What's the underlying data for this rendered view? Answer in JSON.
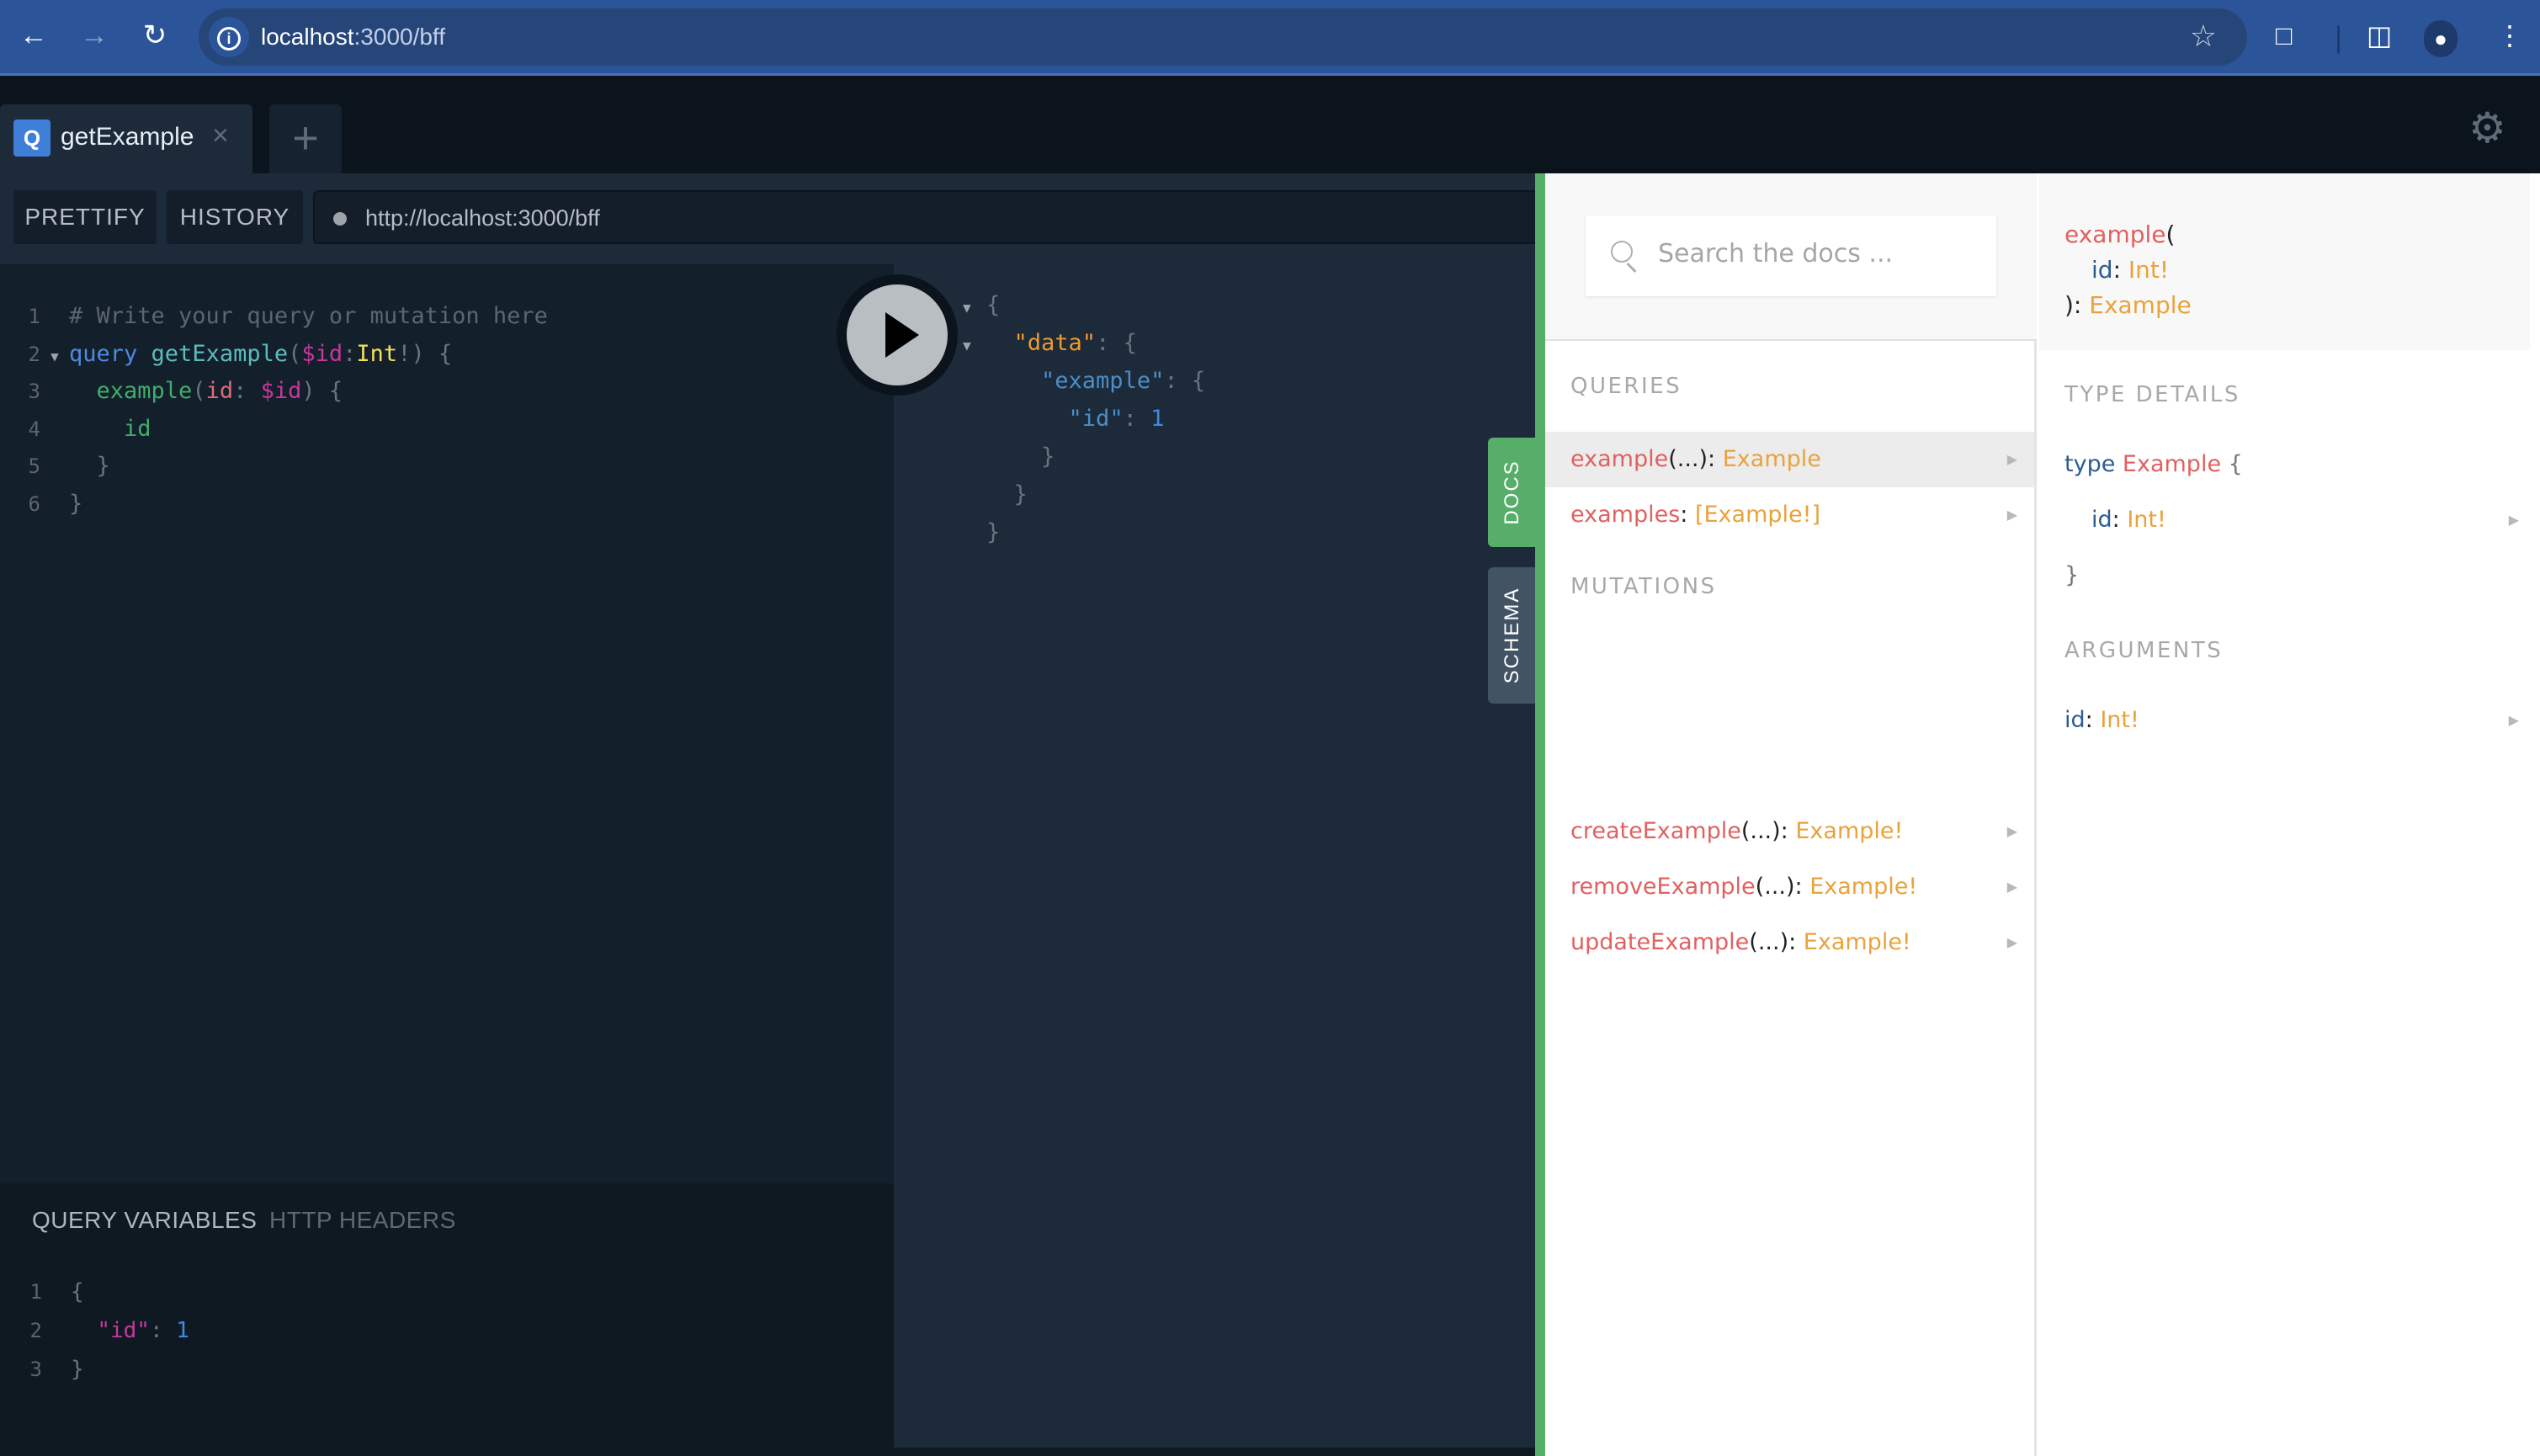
{
  "browser": {
    "url_host": "localhost",
    "url_rest": ":3000/bff",
    "icons": [
      "back-icon",
      "forward-icon",
      "reload-icon",
      "info-icon",
      "star-icon",
      "extensions-icon",
      "side-panel-icon",
      "profile-icon",
      "menu-icon"
    ]
  },
  "tabs": [
    {
      "badge": "Q",
      "title": "getExample",
      "close": "×"
    }
  ],
  "tab_add": "+",
  "toolbar": {
    "prettify": "PRETTIFY",
    "history": "HISTORY",
    "endpoint": "http://localhost:3000/bff"
  },
  "editor": {
    "lines": [
      {
        "n": "1",
        "text": "# Write your query or mutation here"
      },
      {
        "n": "2",
        "text": "query getExample($id:Int!) {"
      },
      {
        "n": "3",
        "text": "  example(id: $id) {"
      },
      {
        "n": "4",
        "text": "    id"
      },
      {
        "n": "5",
        "text": "  }"
      },
      {
        "n": "6",
        "text": "}"
      }
    ],
    "tokens": {
      "comment": "# Write your query or mutation here",
      "kw_query": "query",
      "op_name": "getExample",
      "var": "$id",
      "type": "Int",
      "field": "example",
      "arg": "id",
      "selection": "id"
    }
  },
  "variables": {
    "tab_active": "QUERY VARIABLES",
    "tab_inactive": "HTTP HEADERS",
    "lines": [
      {
        "n": "1",
        "text": "{"
      },
      {
        "n": "2",
        "text": "  \"id\": 1"
      },
      {
        "n": "3",
        "text": "}"
      }
    ],
    "key": "\"id\"",
    "value": "1"
  },
  "response": {
    "data_key": "\"data\"",
    "example_key": "\"example\"",
    "id_key": "\"id\"",
    "id_value": "1"
  },
  "side_tabs": {
    "docs": "DOCS",
    "schema": "SCHEMA"
  },
  "docs": {
    "search_placeholder": "Search the docs ...",
    "queries_title": "QUERIES",
    "queries": [
      {
        "name": "example",
        "args": "(...)",
        "type": "Example",
        "active": true
      },
      {
        "name": "examples",
        "args": "",
        "type": "[Example!]",
        "active": false
      }
    ],
    "mutations_title": "MUTATIONS",
    "mutations": [
      {
        "name": "createExample",
        "args": "(...)",
        "type": "Example!"
      },
      {
        "name": "removeExample",
        "args": "(...)",
        "type": "Example!"
      },
      {
        "name": "updateExample",
        "args": "(...)",
        "type": "Example!"
      }
    ]
  },
  "detail": {
    "signature": {
      "name": "example",
      "arg_name": "id",
      "arg_type": "Int!",
      "return_type": "Example"
    },
    "type_details_title": "TYPE DETAILS",
    "type_kw": "type",
    "type_name": "Example",
    "type_fields": [
      {
        "name": "id",
        "type": "Int!"
      }
    ],
    "arguments_title": "ARGUMENTS",
    "arguments": [
      {
        "name": "id",
        "type": "Int!"
      }
    ]
  },
  "colors": {
    "accent_green": "#56ae68",
    "chrome_blue": "#2b5499",
    "field_name": "#e06160",
    "type_name": "#e8a33c"
  }
}
